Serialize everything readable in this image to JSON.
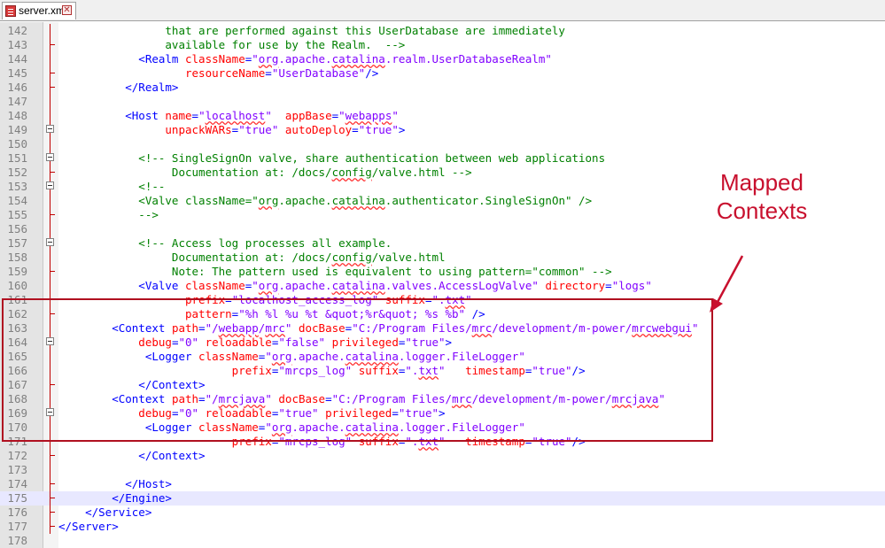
{
  "tab": {
    "label": "server.xml",
    "icon": "file-icon",
    "close_glyph": "✕"
  },
  "annotation": {
    "label_line1": "Mapped",
    "label_line2": "Contexts",
    "color": "#c8102e"
  },
  "highlight": {
    "label": "Mapped Contexts",
    "first_line": "163",
    "last_line": "172"
  },
  "syntax_colors": {
    "tag": "#0000ff",
    "attribute": "#ff0000",
    "value": "#8000ff",
    "comment": "#008000",
    "text": "#000000"
  },
  "lines": [
    {
      "n": "142",
      "fold": "line",
      "segs": [
        [
          "cmt",
          "                that are performed against this UserDatabase are immediately"
        ]
      ]
    },
    {
      "n": "143",
      "fold": "end",
      "segs": [
        [
          "cmt",
          "                available for use by the Realm.  -->"
        ]
      ]
    },
    {
      "n": "144",
      "fold": "line",
      "segs": [
        [
          "tag",
          "            <Realm "
        ],
        [
          "attr",
          "className"
        ],
        [
          "tag",
          "="
        ],
        [
          "val",
          "\"org.apache.catalina.realm.UserDatabaseRealm\""
        ]
      ]
    },
    {
      "n": "145",
      "fold": "end",
      "segs": [
        [
          "attr",
          "                   resourceName"
        ],
        [
          "tag",
          "="
        ],
        [
          "val",
          "\"UserDatabase\""
        ],
        [
          "tag",
          "/>"
        ]
      ]
    },
    {
      "n": "146",
      "fold": "end",
      "segs": [
        [
          "tag",
          "          </Realm>"
        ]
      ]
    },
    {
      "n": "147",
      "fold": "line",
      "segs": [
        [
          "txt",
          ""
        ]
      ]
    },
    {
      "n": "148",
      "fold": "line",
      "segs": [
        [
          "tag",
          "          <Host "
        ],
        [
          "attr",
          "name"
        ],
        [
          "tag",
          "="
        ],
        [
          "val",
          "\"localhost\""
        ],
        [
          "txt",
          "  "
        ],
        [
          "attr",
          "appBase"
        ],
        [
          "tag",
          "="
        ],
        [
          "val",
          "\"webapps\""
        ]
      ]
    },
    {
      "n": "149",
      "fold": "box",
      "segs": [
        [
          "attr",
          "                unpackWARs"
        ],
        [
          "tag",
          "="
        ],
        [
          "val",
          "\"true\""
        ],
        [
          "txt",
          " "
        ],
        [
          "attr",
          "autoDeploy"
        ],
        [
          "tag",
          "="
        ],
        [
          "val",
          "\"true\""
        ],
        [
          "tag",
          ">"
        ]
      ]
    },
    {
      "n": "150",
      "fold": "line",
      "segs": [
        [
          "txt",
          ""
        ]
      ]
    },
    {
      "n": "151",
      "fold": "box",
      "segs": [
        [
          "cmt",
          "            <!-- SingleSignOn valve, share authentication between web applications"
        ]
      ]
    },
    {
      "n": "152",
      "fold": "end",
      "segs": [
        [
          "cmt",
          "                 Documentation at: /docs/config/valve.html -->"
        ]
      ]
    },
    {
      "n": "153",
      "fold": "box",
      "segs": [
        [
          "cmt",
          "            <!--"
        ]
      ]
    },
    {
      "n": "154",
      "fold": "line",
      "segs": [
        [
          "cmt",
          "            <Valve className=\"org.apache.catalina.authenticator.SingleSignOn\" />"
        ]
      ]
    },
    {
      "n": "155",
      "fold": "end",
      "segs": [
        [
          "cmt",
          "            -->"
        ]
      ]
    },
    {
      "n": "156",
      "fold": "line",
      "segs": [
        [
          "txt",
          ""
        ]
      ]
    },
    {
      "n": "157",
      "fold": "box",
      "segs": [
        [
          "cmt",
          "            <!-- Access log processes all example."
        ]
      ]
    },
    {
      "n": "158",
      "fold": "line",
      "segs": [
        [
          "cmt",
          "                 Documentation at: /docs/config/valve.html"
        ]
      ]
    },
    {
      "n": "159",
      "fold": "end",
      "segs": [
        [
          "cmt",
          "                 Note: The pattern used is equivalent to using pattern=\"common\" -->"
        ]
      ]
    },
    {
      "n": "160",
      "fold": "line",
      "segs": [
        [
          "tag",
          "            <Valve "
        ],
        [
          "attr",
          "className"
        ],
        [
          "tag",
          "="
        ],
        [
          "val",
          "\"org.apache.catalina.valves.AccessLogValve\""
        ],
        [
          "txt",
          " "
        ],
        [
          "attr",
          "directory"
        ],
        [
          "tag",
          "="
        ],
        [
          "val",
          "\"logs\""
        ]
      ]
    },
    {
      "n": "161",
      "fold": "line",
      "segs": [
        [
          "attr",
          "                   prefix"
        ],
        [
          "tag",
          "="
        ],
        [
          "val",
          "\"localhost_access_log\""
        ],
        [
          "txt",
          " "
        ],
        [
          "attr",
          "suffix"
        ],
        [
          "tag",
          "="
        ],
        [
          "val",
          "\".txt\""
        ]
      ]
    },
    {
      "n": "162",
      "fold": "end",
      "segs": [
        [
          "attr",
          "                   pattern"
        ],
        [
          "tag",
          "="
        ],
        [
          "val",
          "\"%h %l %u %t &quot;%r&quot; %s %b\""
        ],
        [
          "txt",
          " "
        ],
        [
          "tag",
          "/>"
        ]
      ]
    },
    {
      "n": "163",
      "fold": "line",
      "segs": [
        [
          "tag",
          "        <Context "
        ],
        [
          "attr",
          "path"
        ],
        [
          "tag",
          "="
        ],
        [
          "val",
          "\"/webapp/mrc\""
        ],
        [
          "txt",
          " "
        ],
        [
          "attr",
          "docBase"
        ],
        [
          "tag",
          "="
        ],
        [
          "val",
          "\"C:/Program Files/mrc/development/m-power/mrcwebgui\""
        ]
      ]
    },
    {
      "n": "164",
      "fold": "box",
      "segs": [
        [
          "attr",
          "            debug"
        ],
        [
          "tag",
          "="
        ],
        [
          "val",
          "\"0\""
        ],
        [
          "txt",
          " "
        ],
        [
          "attr",
          "reloadable"
        ],
        [
          "tag",
          "="
        ],
        [
          "val",
          "\"false\""
        ],
        [
          "txt",
          " "
        ],
        [
          "attr",
          "privileged"
        ],
        [
          "tag",
          "="
        ],
        [
          "val",
          "\"true\""
        ],
        [
          "tag",
          ">"
        ]
      ]
    },
    {
      "n": "165",
      "fold": "line",
      "segs": [
        [
          "tag",
          "             <Logger "
        ],
        [
          "attr",
          "className"
        ],
        [
          "tag",
          "="
        ],
        [
          "val",
          "\"org.apache.catalina.logger.FileLogger\""
        ]
      ]
    },
    {
      "n": "166",
      "fold": "line",
      "segs": [
        [
          "attr",
          "                          prefix"
        ],
        [
          "tag",
          "="
        ],
        [
          "val",
          "\"mrcps_log\""
        ],
        [
          "txt",
          " "
        ],
        [
          "attr",
          "suffix"
        ],
        [
          "tag",
          "="
        ],
        [
          "val",
          "\".txt\""
        ],
        [
          "txt",
          "   "
        ],
        [
          "attr",
          "timestamp"
        ],
        [
          "tag",
          "="
        ],
        [
          "val",
          "\"true\""
        ],
        [
          "tag",
          "/>"
        ]
      ]
    },
    {
      "n": "167",
      "fold": "end",
      "segs": [
        [
          "tag",
          "            </Context>"
        ]
      ]
    },
    {
      "n": "168",
      "fold": "line",
      "segs": [
        [
          "tag",
          "        <Context "
        ],
        [
          "attr",
          "path"
        ],
        [
          "tag",
          "="
        ],
        [
          "val",
          "\"/mrcjava\""
        ],
        [
          "txt",
          " "
        ],
        [
          "attr",
          "docBase"
        ],
        [
          "tag",
          "="
        ],
        [
          "val",
          "\"C:/Program Files/mrc/development/m-power/mrcjava\""
        ]
      ]
    },
    {
      "n": "169",
      "fold": "box",
      "segs": [
        [
          "attr",
          "            debug"
        ],
        [
          "tag",
          "="
        ],
        [
          "val",
          "\"0\""
        ],
        [
          "txt",
          " "
        ],
        [
          "attr",
          "reloadable"
        ],
        [
          "tag",
          "="
        ],
        [
          "val",
          "\"true\""
        ],
        [
          "txt",
          " "
        ],
        [
          "attr",
          "privileged"
        ],
        [
          "tag",
          "="
        ],
        [
          "val",
          "\"true\""
        ],
        [
          "tag",
          ">"
        ]
      ]
    },
    {
      "n": "170",
      "fold": "line",
      "segs": [
        [
          "tag",
          "             <Logger "
        ],
        [
          "attr",
          "className"
        ],
        [
          "tag",
          "="
        ],
        [
          "val",
          "\"org.apache.catalina.logger.FileLogger\""
        ]
      ]
    },
    {
      "n": "171",
      "fold": "line",
      "segs": [
        [
          "attr",
          "                          prefix"
        ],
        [
          "tag",
          "="
        ],
        [
          "val",
          "\"mrcps_log\""
        ],
        [
          "txt",
          " "
        ],
        [
          "attr",
          "suffix"
        ],
        [
          "tag",
          "="
        ],
        [
          "val",
          "\".txt\""
        ],
        [
          "txt",
          "   "
        ],
        [
          "attr",
          "timestamp"
        ],
        [
          "tag",
          "="
        ],
        [
          "val",
          "\"true\""
        ],
        [
          "tag",
          "/>"
        ]
      ]
    },
    {
      "n": "172",
      "fold": "end",
      "segs": [
        [
          "tag",
          "            </Context>"
        ]
      ]
    },
    {
      "n": "173",
      "fold": "line",
      "segs": [
        [
          "txt",
          ""
        ]
      ]
    },
    {
      "n": "174",
      "fold": "end",
      "segs": [
        [
          "tag",
          "          </Host>"
        ]
      ]
    },
    {
      "n": "175",
      "fold": "end",
      "current": true,
      "segs": [
        [
          "tag",
          "        </Engine>"
        ]
      ]
    },
    {
      "n": "176",
      "fold": "end",
      "segs": [
        [
          "tag",
          "    </Service>"
        ]
      ]
    },
    {
      "n": "177",
      "fold": "end",
      "segs": [
        [
          "tag",
          "</Server>"
        ]
      ]
    },
    {
      "n": "178",
      "fold": "none",
      "segs": [
        [
          "txt",
          ""
        ]
      ]
    }
  ],
  "spellcheck_words": [
    "org",
    "catalina",
    "localhost",
    "webapps",
    "config",
    "txt",
    "mrc",
    "webapp",
    "mrcwebgui",
    "mrcjava",
    "mrcps"
  ]
}
